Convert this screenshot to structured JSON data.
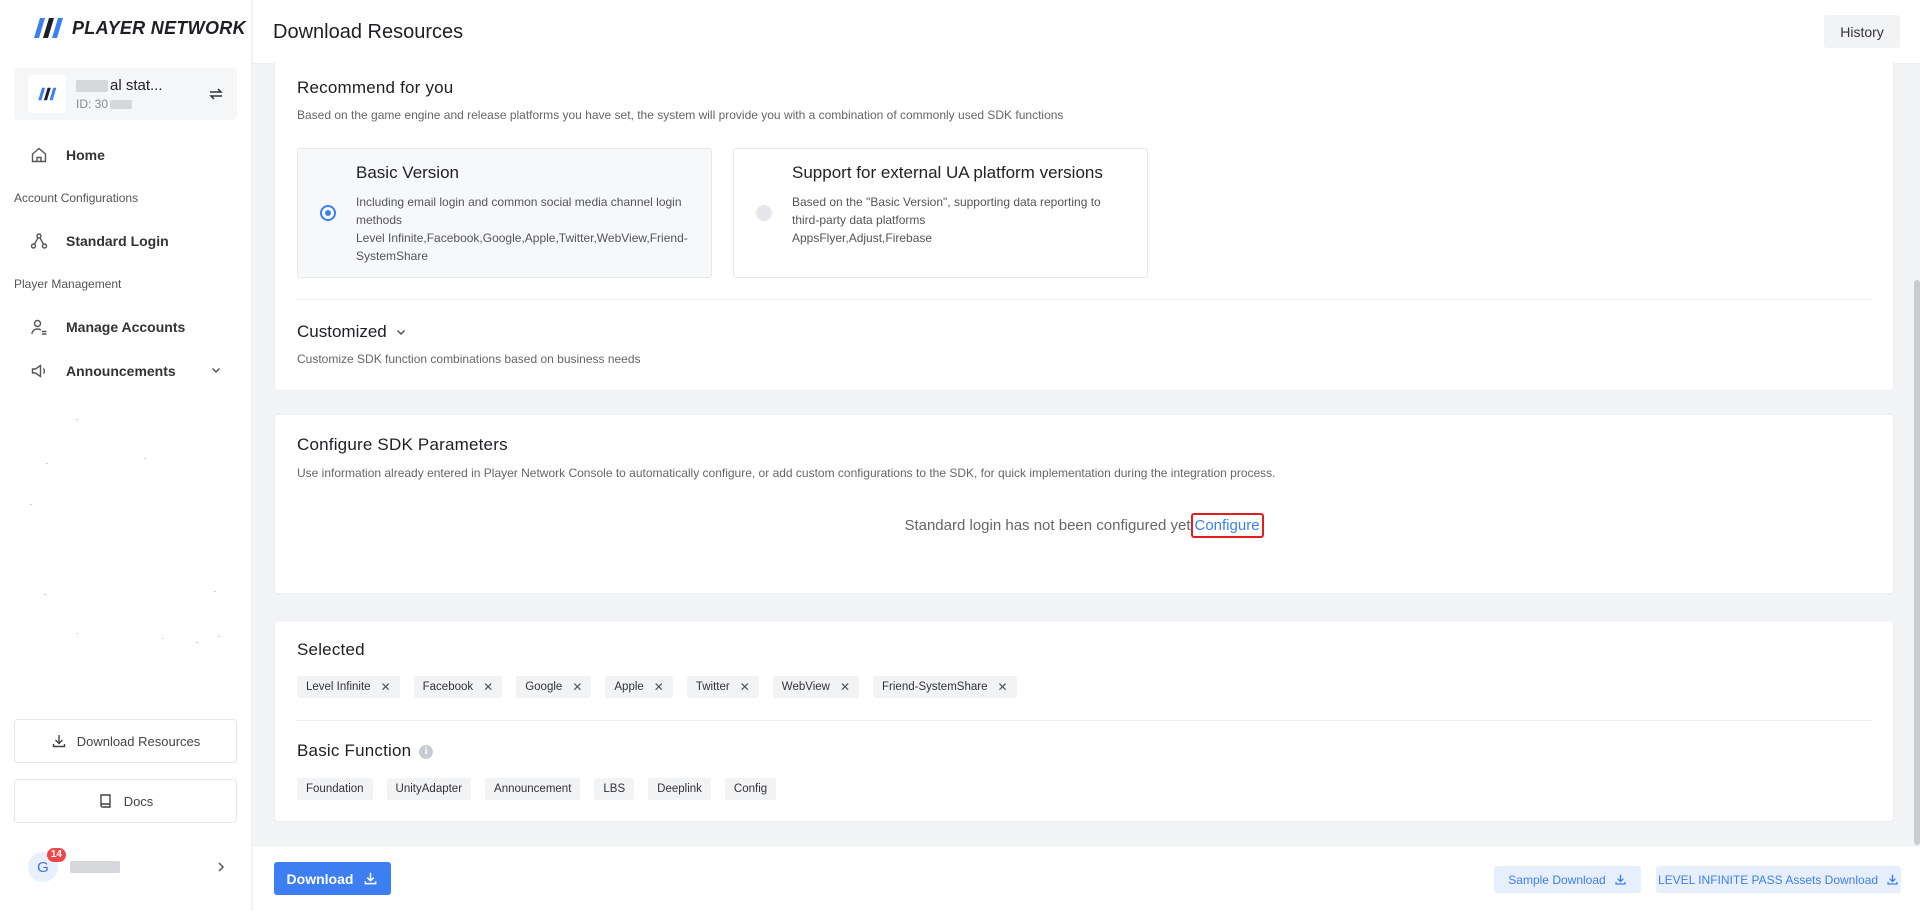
{
  "brand": {
    "name": "PLAYER NETWORK",
    "accent": "#3d7ff2"
  },
  "project": {
    "name_suffix": "al stat...",
    "id_prefix": "ID: 30"
  },
  "sidebar": {
    "home": "Home",
    "section_account": "Account Configurations",
    "standard_login": "Standard Login",
    "section_player": "Player Management",
    "manage_accounts": "Manage Accounts",
    "announcements": "Announcements",
    "download_resources": "Download Resources",
    "docs": "Docs"
  },
  "user": {
    "initial": "G",
    "badge": "14"
  },
  "header": {
    "title": "Download Resources",
    "history": "History"
  },
  "recommend": {
    "title": "Recommend for you",
    "desc": "Based on the game engine and release platforms you have set, the system will provide you with a combination of commonly used SDK functions",
    "options": [
      {
        "title": "Basic Version",
        "desc1": "Including email login and common social media channel login methods",
        "desc2": "Level Infinite,Facebook,Google,Apple,Twitter,WebView,Friend-SystemShare",
        "selected": true
      },
      {
        "title": "Support for external UA platform versions",
        "desc1": "Based on the \"Basic Version\", supporting data reporting to third-party data platforms",
        "desc2": "AppsFlyer,Adjust,Firebase",
        "selected": false
      }
    ],
    "customized_title": "Customized",
    "customized_desc": "Customize SDK function combinations based on business needs"
  },
  "sdk_params": {
    "title": "Configure SDK Parameters",
    "desc": "Use information already entered in Player Network Console to automatically configure, or add custom configurations to the SDK, for quick implementation during the integration process.",
    "notice": "Standard login has not been configured yet",
    "link": "Configure"
  },
  "selected": {
    "title": "Selected",
    "tags": [
      "Level Infinite",
      "Facebook",
      "Google",
      "Apple",
      "Twitter",
      "WebView",
      "Friend-SystemShare"
    ],
    "basic_title": "Basic Function",
    "basic_tags": [
      "Foundation",
      "UnityAdapter",
      "Announcement",
      "LBS",
      "Deeplink",
      "Config"
    ]
  },
  "footer": {
    "download": "Download",
    "sample": "Sample Download",
    "pass_assets": "LEVEL INFINITE PASS Assets Download"
  }
}
